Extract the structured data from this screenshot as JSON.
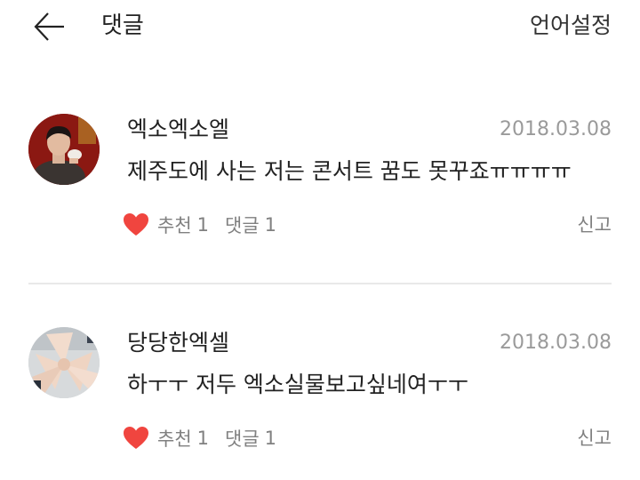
{
  "header": {
    "back_icon": "arrow-left-icon",
    "title": "댓글",
    "language_button": "언어설정"
  },
  "comments": [
    {
      "username": "엑소엑소엘",
      "date": "2018.03.08",
      "text": "제주도에 사는 저는 콘서트 꿈도 못꾸죠ㅠㅠㅠㅠ",
      "like_label": "추천",
      "like_count": "1",
      "reply_label": "댓글",
      "reply_count": "1",
      "report_label": "신고"
    },
    {
      "username": "당당한엑셀",
      "date": "2018.03.08",
      "text": "하ㅜㅜ 저두 엑소실물보고싶네여ㅜㅜ",
      "like_label": "추천",
      "like_count": "1",
      "reply_label": "댓글",
      "reply_count": "1",
      "report_label": "신고"
    }
  ],
  "colors": {
    "heart": "#f0453f",
    "meta_text": "#808080",
    "date_text": "#9a9a9a",
    "divider": "#e9e9e9"
  }
}
